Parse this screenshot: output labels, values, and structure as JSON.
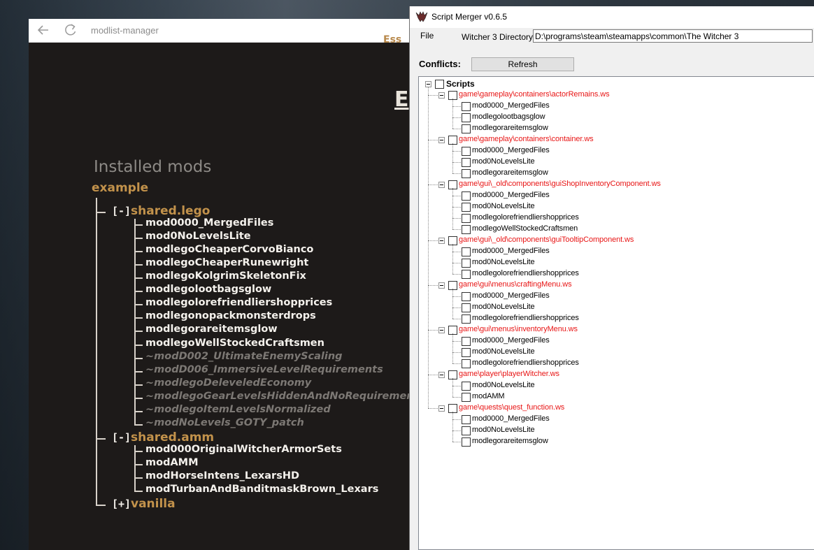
{
  "modlist_manager": {
    "title": "modlist-manager",
    "partial_top_text": "Ess",
    "partial_heading": "E",
    "heading": "Installed mods",
    "profile": "example",
    "groups": [
      {
        "toggle": "[-]",
        "name": "shared.lego",
        "mods": [
          {
            "name": "mod0000_MergedFiles",
            "enabled": true
          },
          {
            "name": "mod0NoLevelsLite",
            "enabled": true
          },
          {
            "name": "modlegoCheaperCorvoBianco",
            "enabled": true
          },
          {
            "name": "modlegoCheaperRunewright",
            "enabled": true
          },
          {
            "name": "modlegoKolgrimSkeletonFix",
            "enabled": true
          },
          {
            "name": "modlegolootbagsglow",
            "enabled": true
          },
          {
            "name": "modlegolorefriendliershopprices",
            "enabled": true
          },
          {
            "name": "modlegonopackmonsterdrops",
            "enabled": true
          },
          {
            "name": "modlegorareitemsglow",
            "enabled": true
          },
          {
            "name": "modlegoWellStockedCraftsmen",
            "enabled": true
          },
          {
            "name": "~modD002_UltimateEnemyScaling",
            "enabled": false
          },
          {
            "name": "~modD006_ImmersiveLevelRequirements",
            "enabled": false
          },
          {
            "name": "~modlegoDeleveledEconomy",
            "enabled": false
          },
          {
            "name": "~modlegoGearLevelsHiddenAndNoRequirements",
            "enabled": false
          },
          {
            "name": "~modlegoItemLevelsNormalized",
            "enabled": false
          },
          {
            "name": "~modNoLevels_GOTY_patch",
            "enabled": false
          }
        ]
      },
      {
        "toggle": "[-]",
        "name": "shared.amm",
        "mods": [
          {
            "name": "mod000OriginalWitcherArmorSets",
            "enabled": true
          },
          {
            "name": "modAMM",
            "enabled": true
          },
          {
            "name": "modHorseIntens_LexarsHD",
            "enabled": true
          },
          {
            "name": "modTurbanAndBanditmaskBrown_Lexars",
            "enabled": true
          }
        ]
      },
      {
        "toggle": "[+]",
        "name": "vanilla",
        "mods": []
      }
    ]
  },
  "script_merger": {
    "title": "Script Merger v0.6.5",
    "menu_file": "File",
    "dir_label": "Witcher 3 Directory:",
    "dir_value": "D:\\programs\\steam\\steamapps\\common\\The Witcher 3",
    "conflicts_label": "Conflicts:",
    "refresh_label": "Refresh",
    "root_label": "Scripts",
    "files": [
      {
        "path": "game\\gameplay\\containers\\actorRemains.ws",
        "mods": [
          "mod0000_MergedFiles",
          "modlegolootbagsglow",
          "modlegorareitemsglow"
        ]
      },
      {
        "path": "game\\gameplay\\containers\\container.ws",
        "mods": [
          "mod0000_MergedFiles",
          "mod0NoLevelsLite",
          "modlegorareitemsglow"
        ]
      },
      {
        "path": "game\\gui\\_old\\components\\guiShopInventoryComponent.ws",
        "mods": [
          "mod0000_MergedFiles",
          "mod0NoLevelsLite",
          "modlegolorefriendliershopprices",
          "modlegoWellStockedCraftsmen"
        ]
      },
      {
        "path": "game\\gui\\_old\\components\\guiTooltipComponent.ws",
        "mods": [
          "mod0000_MergedFiles",
          "mod0NoLevelsLite",
          "modlegolorefriendliershopprices"
        ]
      },
      {
        "path": "game\\gui\\menus\\craftingMenu.ws",
        "mods": [
          "mod0000_MergedFiles",
          "mod0NoLevelsLite",
          "modlegolorefriendliershopprices"
        ]
      },
      {
        "path": "game\\gui\\menus\\inventoryMenu.ws",
        "mods": [
          "mod0000_MergedFiles",
          "mod0NoLevelsLite",
          "modlegolorefriendliershopprices"
        ]
      },
      {
        "path": "game\\player\\playerWitcher.ws",
        "mods": [
          "mod0NoLevelsLite",
          "modAMM"
        ]
      },
      {
        "path": "game\\quests\\quest_function.ws",
        "mods": [
          "mod0000_MergedFiles",
          "mod0NoLevelsLite",
          "modlegorareitemsglow"
        ]
      }
    ]
  }
}
